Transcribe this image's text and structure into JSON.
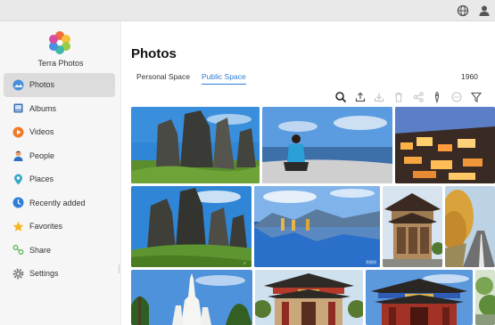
{
  "app": {
    "name": "Terra Photos"
  },
  "topbar": {
    "icons": [
      "globe-icon",
      "user-icon"
    ]
  },
  "sidebar": {
    "items": [
      {
        "label": "Photos",
        "icon": "photos-icon",
        "active": true
      },
      {
        "label": "Albums",
        "icon": "albums-icon"
      },
      {
        "label": "Videos",
        "icon": "videos-icon"
      },
      {
        "label": "People",
        "icon": "people-icon"
      },
      {
        "label": "Places",
        "icon": "places-icon"
      },
      {
        "label": "Recently added",
        "icon": "recently-added-icon"
      },
      {
        "label": "Favorites",
        "icon": "favorites-icon"
      },
      {
        "label": "Share",
        "icon": "share-icon"
      },
      {
        "label": "Settings",
        "icon": "settings-icon"
      }
    ]
  },
  "main": {
    "title": "Photos",
    "tabs": [
      {
        "label": "Personal Space",
        "active": false
      },
      {
        "label": "Public Space",
        "active": true
      }
    ],
    "count": "1960",
    "toolbar": [
      "search-icon",
      "upload-icon",
      "download-icon",
      "delete-icon",
      "share-icon",
      "tag-icon",
      "more-icon",
      "filter-icon"
    ]
  },
  "photos": [
    {
      "subject": "stone-forest"
    },
    {
      "subject": "person-on-beach"
    },
    {
      "subject": "night-old-town"
    },
    {
      "subject": "stone-forest"
    },
    {
      "subject": "lake-mountain-reflection",
      "watermark": "黑颜网"
    },
    {
      "subject": "chinese-pavilion"
    },
    {
      "subject": "autumn-road"
    },
    {
      "subject": "white-pagoda"
    },
    {
      "subject": "temple-gate"
    },
    {
      "subject": "ornate-archway"
    },
    {
      "subject": "greenery"
    }
  ],
  "colors": {
    "accent": "#2a7bd8",
    "sidebar_bg": "#f6f6f6",
    "active_item_bg": "#dcdcdc",
    "topbar_bg": "#e9e9e9"
  }
}
